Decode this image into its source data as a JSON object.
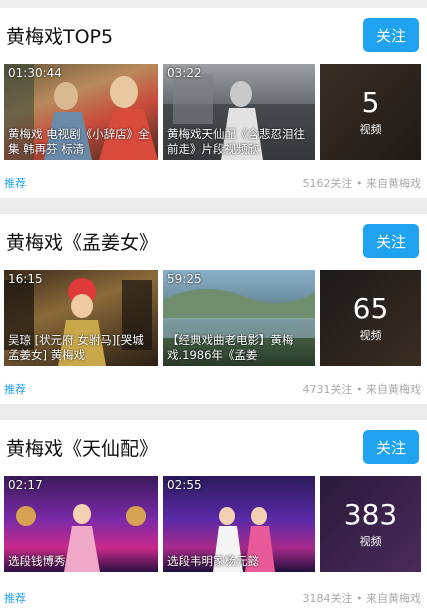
{
  "cards": [
    {
      "title": "黄梅戏TOP5",
      "follow_label": "关注",
      "thumbs": [
        {
          "duration": "01:30:44",
          "caption": "黄梅戏 电视剧《小辞店》全集 韩再芬 标清"
        },
        {
          "duration": "03:22",
          "caption": "黄梅戏天仙配《含悲忍泪往前走》片段视频欣"
        },
        {
          "count": "5",
          "unit": "视频"
        }
      ],
      "tag": "推荐",
      "meta": "5162关注 • 来自黄梅戏"
    },
    {
      "title": "黄梅戏《孟姜女》",
      "follow_label": "关注",
      "thumbs": [
        {
          "duration": "16:15",
          "caption": "吴琼 [状元府 女驸马][哭城 孟姜女] 黄梅戏"
        },
        {
          "duration": "59:25",
          "caption": "【经典戏曲老电影】黄梅戏.1986年《孟姜"
        },
        {
          "count": "65",
          "unit": "视频"
        }
      ],
      "tag": "推荐",
      "meta": "4731关注 • 来自黄梅戏"
    },
    {
      "title": "黄梅戏《天仙配》",
      "follow_label": "关注",
      "thumbs": [
        {
          "duration": "02:17",
          "caption": "选段钱博秀"
        },
        {
          "duration": "02:55",
          "caption": "选段韦明家杨元懿"
        },
        {
          "count": "383",
          "unit": "视频"
        }
      ],
      "tag": "推荐",
      "meta": "3184关注 • 来自黄梅戏"
    }
  ]
}
